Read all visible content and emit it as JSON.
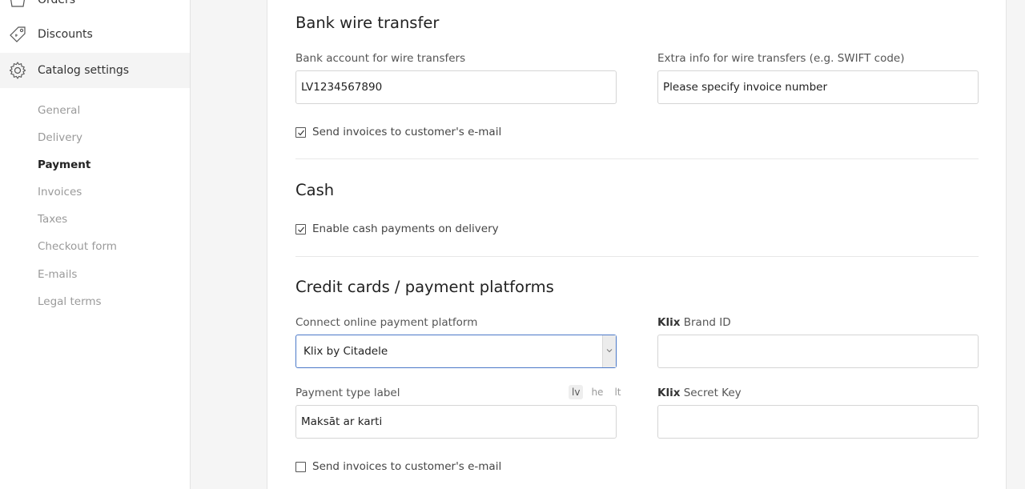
{
  "sidebar": {
    "orders_label": "Orders",
    "discounts_label": "Discounts",
    "catalog_settings_label": "Catalog settings",
    "sub_items": [
      "General",
      "Delivery",
      "Payment",
      "Invoices",
      "Taxes",
      "Checkout form",
      "E-mails",
      "Legal terms"
    ],
    "active_sub_item": "Payment"
  },
  "bank": {
    "title": "Bank wire transfer",
    "account_label": "Bank account for wire transfers",
    "account_value": "LV1234567890",
    "extra_label": "Extra info for wire transfers (e.g. SWIFT code)",
    "extra_value": "Please specify invoice number",
    "send_invoices_label": "Send invoices to customer's e-mail",
    "send_invoices_checked": true
  },
  "cash": {
    "title": "Cash",
    "enable_label": "Enable cash payments on delivery",
    "enable_checked": true
  },
  "cards": {
    "title": "Credit cards / payment platforms",
    "platform_label": "Connect online payment platform",
    "platform_value": "Klix by Citadele",
    "brand_id_label_bold": "Klix",
    "brand_id_label_rest": " Brand ID",
    "brand_id_value": "",
    "type_label": "Payment type label",
    "type_value": "Maksāt ar karti",
    "languages": [
      "lv",
      "he",
      "lt"
    ],
    "active_language": "lv",
    "secret_label_bold": "Klix",
    "secret_label_rest": " Secret Key",
    "secret_value": "",
    "send_invoices_label": "Send invoices to customer's e-mail",
    "send_invoices_checked": false
  },
  "colors": {
    "accent_border": "#4b79c8",
    "sidebar_active_bg": "#f4f4f4"
  }
}
